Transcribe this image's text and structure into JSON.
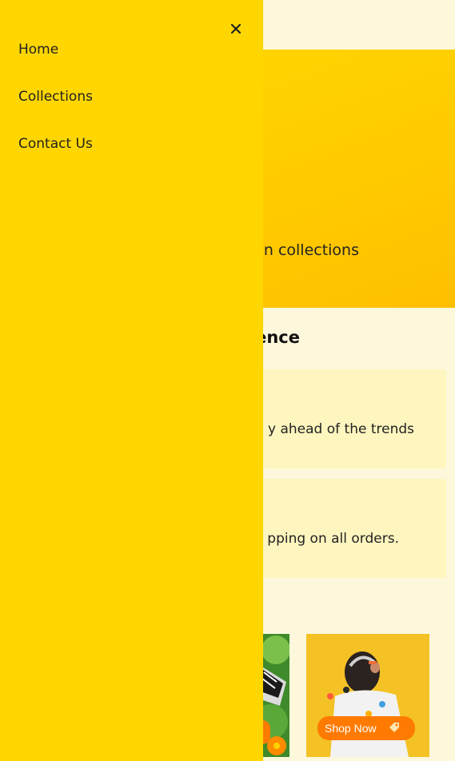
{
  "hero": {
    "text_partial": "n collections"
  },
  "experience": {
    "heading_partial": "ence",
    "cards": [
      {
        "text_partial": "y ahead of the trends"
      },
      {
        "text_partial": "pping on all orders."
      }
    ]
  },
  "products": {
    "shop_now_label": "Shop Now"
  },
  "drawer": {
    "close_icon": "close-icon",
    "nav": [
      {
        "label": "Home"
      },
      {
        "label": "Collections"
      },
      {
        "label": "Contact Us"
      }
    ]
  },
  "colors": {
    "page_bg": "#fdf8dc",
    "drawer_bg": "#ffd600",
    "hero_yellow": "#ffcc00",
    "card_bg": "#fff6bf",
    "accent_orange": "#ff7a00"
  }
}
